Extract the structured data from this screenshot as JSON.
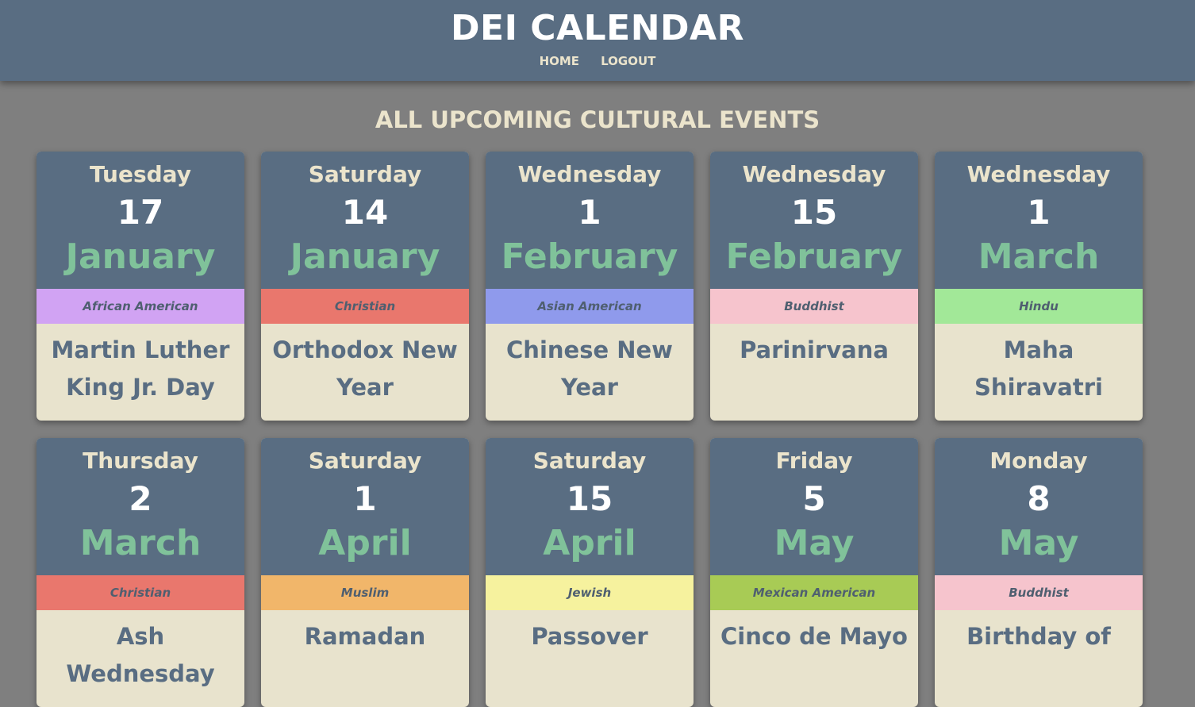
{
  "header": {
    "title": "DEI CALENDAR",
    "nav": [
      {
        "label": "HOME"
      },
      {
        "label": "LOGOUT"
      }
    ]
  },
  "page": {
    "heading": "ALL UPCOMING CULTURAL EVENTS"
  },
  "events": [
    {
      "weekday": "Tuesday",
      "day": "17",
      "month": "January",
      "category": "African American",
      "category_color": "#d1a3f3",
      "name": "Martin Luther King Jr. Day"
    },
    {
      "weekday": "Saturday",
      "day": "14",
      "month": "January",
      "category": "Christian",
      "category_color": "#e9776d",
      "name": "Orthodox New Year"
    },
    {
      "weekday": "Wednesday",
      "day": "1",
      "month": "February",
      "category": "Asian American",
      "category_color": "#8f9aec",
      "name": "Chinese New Year"
    },
    {
      "weekday": "Wednesday",
      "day": "15",
      "month": "February",
      "category": "Buddhist",
      "category_color": "#f6c4cd",
      "name": "Parinirvana"
    },
    {
      "weekday": "Wednesday",
      "day": "1",
      "month": "March",
      "category": "Hindu",
      "category_color": "#a2e898",
      "name": "Maha Shiravatri"
    },
    {
      "weekday": "Thursday",
      "day": "2",
      "month": "March",
      "category": "Christian",
      "category_color": "#e9776d",
      "name": "Ash Wednesday"
    },
    {
      "weekday": "Saturday",
      "day": "1",
      "month": "April",
      "category": "Muslim",
      "category_color": "#f1b66a",
      "name": "Ramadan"
    },
    {
      "weekday": "Saturday",
      "day": "15",
      "month": "April",
      "category": "Jewish",
      "category_color": "#f6f29e",
      "name": "Passover"
    },
    {
      "weekday": "Friday",
      "day": "5",
      "month": "May",
      "category": "Mexican American",
      "category_color": "#a8cb55",
      "name": "Cinco de Mayo"
    },
    {
      "weekday": "Monday",
      "day": "8",
      "month": "May",
      "category": "Buddhist",
      "category_color": "#f6c4cd",
      "name": "Birthday of"
    }
  ],
  "colors": {
    "header_bg": "#596d82",
    "page_bg": "#7f7f7f",
    "card_body_bg": "#e8e3cd",
    "month_green": "#80c29a"
  }
}
